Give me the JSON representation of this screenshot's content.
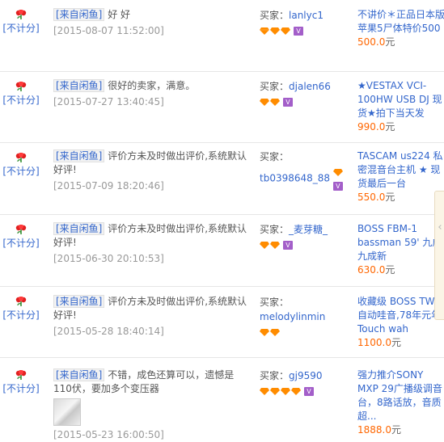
{
  "labels": {
    "rating": "[不计分]",
    "buyer": "买家：",
    "source": "[来自闲鱼]",
    "currency": "元"
  },
  "rows": [
    {
      "comment": "好 好",
      "date": "[2015-08-07 11:52:00]",
      "buyer": "lanlyc1",
      "gems": 3,
      "item": "不讲价＊正品日本版苹果5尸体特价500",
      "price": "500.0"
    },
    {
      "comment": "很好的卖家，满意。",
      "date": "[2015-07-27 13:40:45]",
      "buyer": "djalen66",
      "gems": 2,
      "item": "★VESTAX VCI-100HW USB DJ 现货★拍下当天发",
      "price": "990.0"
    },
    {
      "comment": "评价方未及时做出评价,系统默认好评!",
      "date": "[2015-07-09 18:20:46]",
      "buyer": "tb0398648_88",
      "gems": 1,
      "item": "TASCAM us224 私密混音台主机 ★ 现货最后一台",
      "price": "550.0"
    },
    {
      "comment": "评价方未及时做出评价,系统默认好评!",
      "date": "[2015-06-30 20:10:53]",
      "buyer": "_麦芽糖_",
      "gems": 2,
      "item": "BOSS FBM-1 bassman 59' 九成九成新",
      "price": "630.0"
    },
    {
      "comment": "评价方未及时做出评价,系统默认好评!",
      "date": "[2015-05-28 18:40:14]",
      "buyer": "melodylinmin",
      "gems": 2,
      "item": "收藏级 BOSS TW-1 自动哇音,78年元年 Touch wah",
      "price": "1100.0"
    },
    {
      "comment": "不错，成色还算可以，遗憾是110伏，要加多个变压器",
      "date": "[2015-05-23 16:00:50]",
      "buyer": "gj9590",
      "gems": 4,
      "item": "强力推介SONY MXP 29广播级调音台，8路话放，音质超...",
      "price": "1888.0"
    }
  ]
}
